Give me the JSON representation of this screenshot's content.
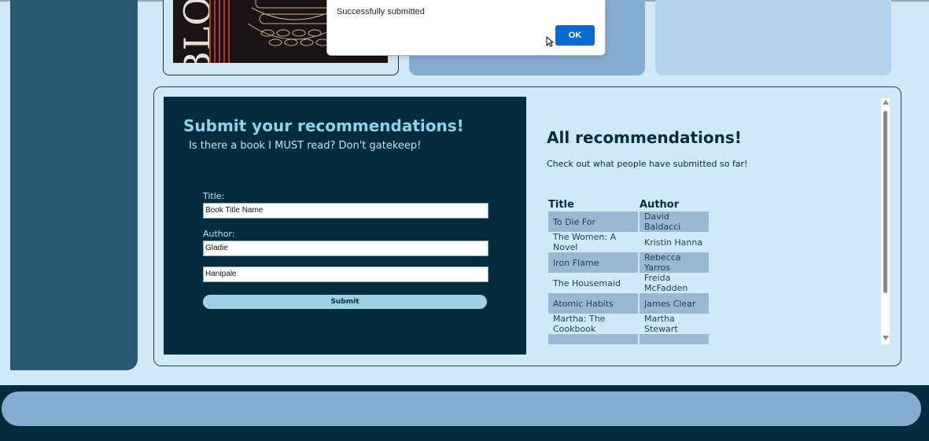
{
  "dialog": {
    "message": "Successfully submitted",
    "ok_label": "OK"
  },
  "book_cover": {
    "letters": "BLO"
  },
  "form": {
    "title": "Submit your recommendations!",
    "subtitle": "Is there a book I MUST read? Don't gatekeep!",
    "title_label": "Title:",
    "title_value": "Book Title Name",
    "author_label": "Author:",
    "author_first_value": "Gladie",
    "author_last_value": "Hanipale",
    "submit_label": "Submit"
  },
  "recommendations": {
    "title": "All recommendations!",
    "subtitle": "Check out what people have submitted so far!",
    "columns": [
      "Title",
      "Author"
    ],
    "rows": [
      {
        "title": "To Die For",
        "author": "David Baldacci"
      },
      {
        "title": "The Women: A Novel",
        "author": "Kristin Hanna"
      },
      {
        "title": "Iron Flame",
        "author": "Rebecca Yarros"
      },
      {
        "title": "The Housemaid",
        "author": "Freida McFadden"
      },
      {
        "title": "Atomic Habits",
        "author": "James Clear"
      },
      {
        "title": "Martha: The Cookbook",
        "author": "Martha Stewart"
      },
      {
        "title": "",
        "author": ""
      }
    ]
  },
  "colors": {
    "dark_navy": "#052c3e",
    "sidebar": "#275a72",
    "accent_light": "#8fd3ec",
    "page_bg": "#cfe9f8",
    "ok_button": "#0a6ad0"
  },
  "icons": {
    "cursor": "mouse-pointer-icon"
  }
}
